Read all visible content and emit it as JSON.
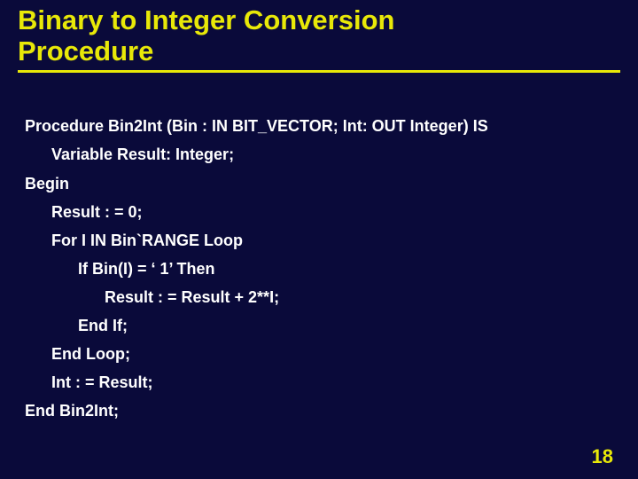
{
  "title": {
    "line1": "Binary to Integer Conversion",
    "line2": "Procedure"
  },
  "code": {
    "l1": "Procedure Bin2Int (Bin : IN BIT_VECTOR;  Int: OUT Integer)  IS",
    "l2": "Variable Result: Integer;",
    "l3": "Begin",
    "l4": "Result : = 0;",
    "l5": "For I IN Bin`RANGE Loop",
    "l6": "If Bin(I) = ‘ 1’ Then",
    "l7": "Result : = Result + 2**I;",
    "l8": "End If;",
    "l9": "End Loop;",
    "l10": "Int : = Result;",
    "l11": "End Bin2Int;"
  },
  "page_number": "18"
}
